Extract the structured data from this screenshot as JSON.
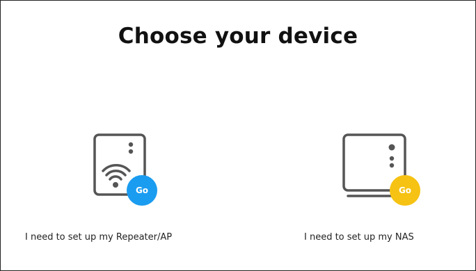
{
  "page": {
    "title": "Choose your device"
  },
  "devices": [
    {
      "id": "repeater",
      "label": "I need to set up my Repeater/AP",
      "go_label": "Go",
      "icon": "repeater-ap-icon",
      "accent_color": "#1a9cf0"
    },
    {
      "id": "nas",
      "label": "I need to set up my NAS",
      "go_label": "Go",
      "icon": "nas-icon",
      "accent_color": "#f6c213"
    }
  ]
}
